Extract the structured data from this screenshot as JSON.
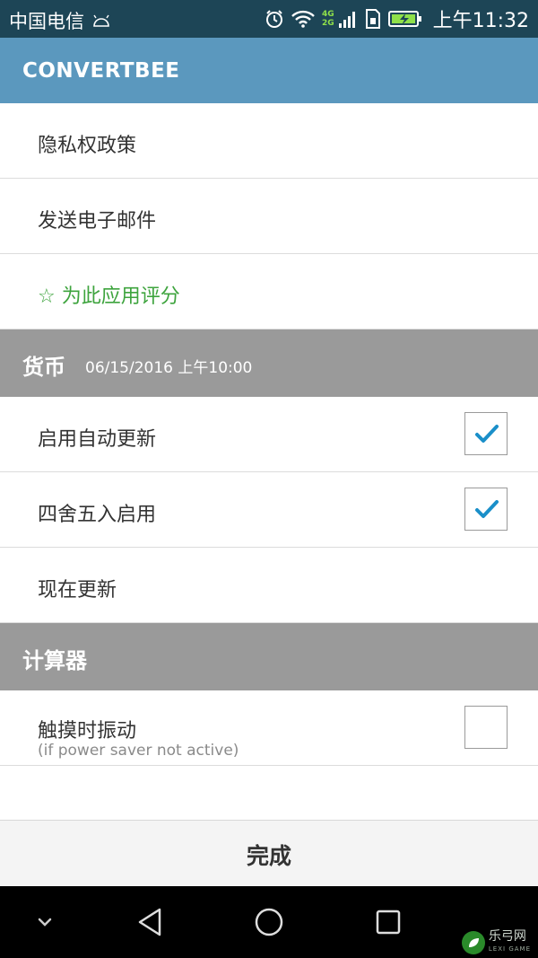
{
  "status_bar": {
    "carrier": "中国电信",
    "network_top": "4G",
    "network_bottom": "2G",
    "time": "上午11:32",
    "icons": [
      "android-icon",
      "alarm-icon",
      "wifi-icon",
      "signal-icon",
      "sim-icon",
      "battery-charging-icon"
    ]
  },
  "app_bar": {
    "title": "CONVERTBEE"
  },
  "rows_top": [
    {
      "label": "隐私权政策"
    },
    {
      "label": "发送电子邮件"
    },
    {
      "star": "☆",
      "label": "为此应用评分"
    }
  ],
  "currency_section": {
    "title": "货币",
    "date": "06/15/2016 上午10:00",
    "rows": [
      {
        "label": "启用自动更新",
        "checked": true
      },
      {
        "label": "四舍五入启用",
        "checked": true
      },
      {
        "label": "现在更新"
      }
    ]
  },
  "calculator_section": {
    "title": "计算器",
    "rows": [
      {
        "label": "触摸时振动",
        "sublabel": "(if power saver not active)",
        "checked": false
      }
    ]
  },
  "done_button": {
    "label": "完成"
  },
  "nav_bar": {
    "icons": [
      "chevron-down-icon",
      "back-icon",
      "home-icon",
      "recents-icon"
    ]
  },
  "watermark": {
    "text": "乐弓网",
    "sub": "LEXI GAME"
  },
  "colors": {
    "status_bar": "#1d4556",
    "app_bar": "#5b98be",
    "section_header": "#9a9a9a",
    "accent_green": "#3ea43e",
    "check_blue": "#1a8fc9"
  }
}
